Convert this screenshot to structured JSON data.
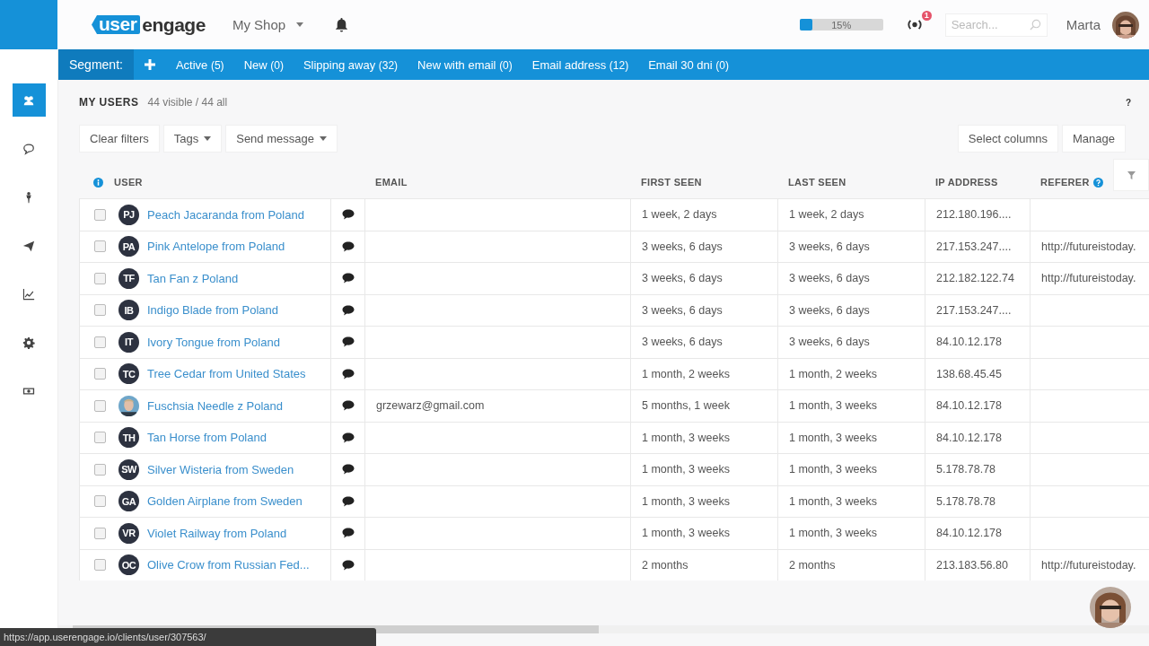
{
  "header": {
    "logo": {
      "tag": "user",
      "word": "engage"
    },
    "shop": "My Shop",
    "progress": {
      "level": 0.15,
      "reading": "15%"
    },
    "notifications": "1",
    "search": {
      "placeholder": "Search..."
    },
    "user_name": "Marta"
  },
  "sidebar": {
    "items": [
      {
        "kind": "users",
        "selected": true
      },
      {
        "kind": "chat",
        "selected": false
      },
      {
        "kind": "pin",
        "selected": false
      },
      {
        "kind": "send",
        "selected": false
      },
      {
        "kind": "chart",
        "selected": false
      },
      {
        "kind": "settings",
        "selected": false
      },
      {
        "kind": "money",
        "selected": false
      }
    ]
  },
  "segments": {
    "label": "Segment:",
    "items": [
      {
        "label": "Active",
        "count": "(5)"
      },
      {
        "label": "New",
        "count": "(0)"
      },
      {
        "label": "Slipping away",
        "count": "(32)"
      },
      {
        "label": "New with email",
        "count": "(0)"
      },
      {
        "label": "Email address",
        "count": "(12)"
      },
      {
        "label": "Email 30 dni",
        "count": "(0)"
      }
    ]
  },
  "title": {
    "heading": "MY USERS",
    "count": "44 visible / 44 all",
    "help": "?"
  },
  "toolbar": {
    "left": [
      {
        "label": "Clear filters",
        "dropdown": false
      },
      {
        "label": "Tags",
        "dropdown": true
      },
      {
        "label": "Send message",
        "dropdown": true
      }
    ],
    "right": [
      "Select columns",
      "Manage"
    ]
  },
  "table": {
    "columns": [
      "USER",
      "EMAIL",
      "FIRST SEEN",
      "LAST SEEN",
      "IP ADDRESS",
      "REFERER"
    ],
    "rows": [
      {
        "kind": "initials",
        "initials": "PJ",
        "name": "Peach Jacaranda from Poland",
        "email": "",
        "first_seen": "1 week, 2 days",
        "last_seen": "1 week, 2 days",
        "ip": "212.180.196....",
        "referer": "",
        "checked": false
      },
      {
        "kind": "initials",
        "initials": "PA",
        "name": "Pink Antelope from Poland",
        "email": "",
        "first_seen": "3 weeks, 6 days",
        "last_seen": "3 weeks, 6 days",
        "ip": "217.153.247....",
        "referer": "http://futureistoday.",
        "checked": false
      },
      {
        "kind": "initials",
        "initials": "TF",
        "name": "Tan Fan z Poland",
        "email": "",
        "first_seen": "3 weeks, 6 days",
        "last_seen": "3 weeks, 6 days",
        "ip": "212.182.122.74",
        "referer": "http://futureistoday.",
        "checked": false
      },
      {
        "kind": "initials",
        "initials": "IB",
        "name": "Indigo Blade from Poland",
        "email": "",
        "first_seen": "3 weeks, 6 days",
        "last_seen": "3 weeks, 6 days",
        "ip": "217.153.247....",
        "referer": "",
        "checked": false
      },
      {
        "kind": "initials",
        "initials": "IT",
        "name": "Ivory Tongue from Poland",
        "email": "",
        "first_seen": "3 weeks, 6 days",
        "last_seen": "3 weeks, 6 days",
        "ip": "84.10.12.178",
        "referer": "",
        "checked": false
      },
      {
        "kind": "initials",
        "initials": "TC",
        "name": "Tree Cedar from United States",
        "email": "",
        "first_seen": "1 month, 2 weeks",
        "last_seen": "1 month, 2 weeks",
        "ip": "138.68.45.45",
        "referer": "",
        "checked": false
      },
      {
        "name": "Fuschsia Needle z Poland",
        "email": "grzewarz@gmail.com",
        "first_seen": "5 months, 1 week",
        "last_seen": "1 month, 3 weeks",
        "ip": "84.10.12.178",
        "referer": "",
        "checked": false
      },
      {
        "kind": "initials",
        "initials": "TH",
        "name": "Tan Horse from Poland",
        "email": "",
        "first_seen": "1 month, 3 weeks",
        "last_seen": "1 month, 3 weeks",
        "ip": "84.10.12.178",
        "referer": "",
        "checked": false
      },
      {
        "kind": "initials",
        "initials": "SW",
        "name": "Silver Wisteria from Sweden",
        "email": "",
        "first_seen": "1 month, 3 weeks",
        "last_seen": "1 month, 3 weeks",
        "ip": "5.178.78.78",
        "referer": "",
        "checked": false
      },
      {
        "kind": "initials",
        "initials": "GA",
        "name": "Golden Airplane from Sweden",
        "email": "",
        "first_seen": "1 month, 3 weeks",
        "last_seen": "1 month, 3 weeks",
        "ip": "5.178.78.78",
        "referer": "",
        "checked": false
      },
      {
        "kind": "initials",
        "initials": "VR",
        "name": "Violet Railway from Poland",
        "email": "",
        "first_seen": "1 month, 3 weeks",
        "last_seen": "1 month, 3 weeks",
        "ip": "84.10.12.178",
        "referer": "",
        "checked": false
      },
      {
        "kind": "initials",
        "initials": "OC",
        "name": "Olive Crow from Russian Fed...",
        "email": "",
        "first_seen": "2 months",
        "last_seen": "2 months",
        "ip": "213.183.56.80",
        "referer": "http://futureistoday.",
        "checked": false
      }
    ]
  },
  "status_bar": {
    "url": "https://app.userengage.io/clients/user/307563/"
  }
}
